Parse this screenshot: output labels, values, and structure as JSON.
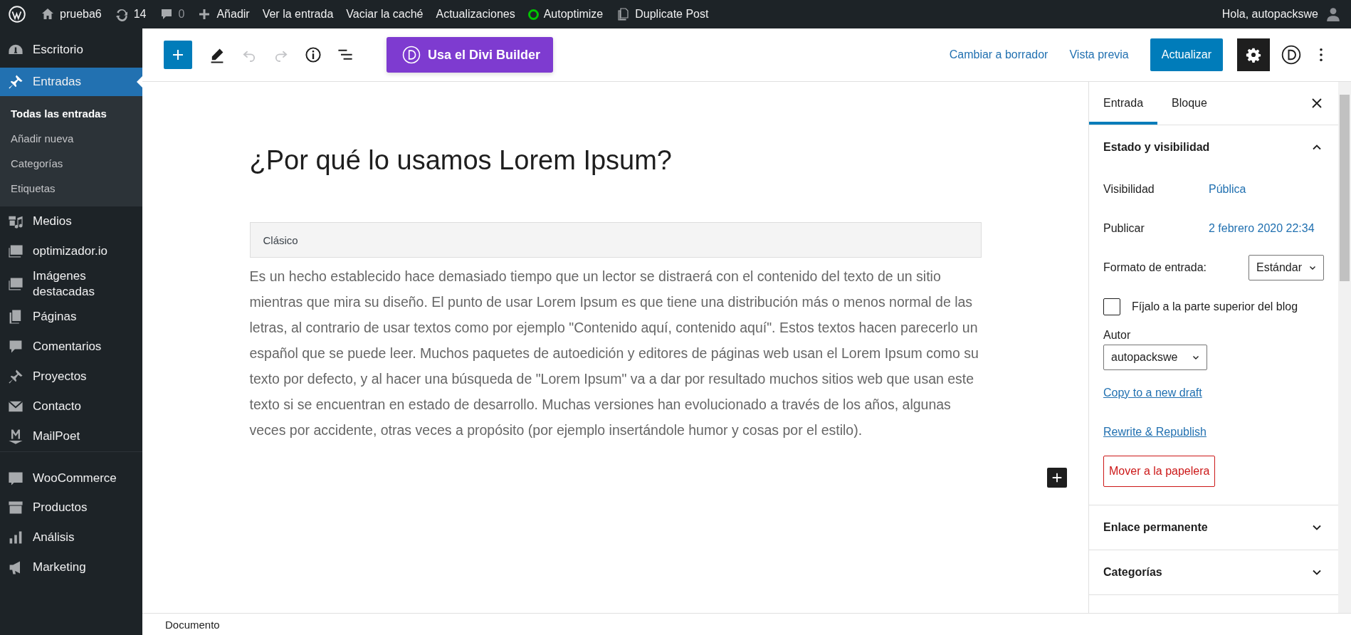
{
  "admin_bar": {
    "items": [
      {
        "kind": "logo"
      },
      {
        "kind": "site",
        "label": "prueba6"
      },
      {
        "kind": "updates",
        "label": "14"
      },
      {
        "kind": "comments",
        "label": "0"
      },
      {
        "kind": "new",
        "label": "Añadir"
      },
      {
        "kind": "link",
        "label": "Ver la entrada"
      },
      {
        "kind": "link",
        "label": "Vaciar la caché"
      },
      {
        "kind": "link",
        "label": "Actualizaciones"
      },
      {
        "kind": "status",
        "label": "Autoptimize",
        "color": "#00c400"
      },
      {
        "kind": "duplicate",
        "label": "Duplicate Post"
      }
    ],
    "greeting": "Hola, autopackswe"
  },
  "sidebar": {
    "items": [
      {
        "label": "Escritorio",
        "selected": false
      },
      {
        "label": "Entradas",
        "selected": true,
        "children": [
          {
            "label": "Todas las entradas",
            "selected": true
          },
          {
            "label": "Añadir nueva",
            "selected": false
          },
          {
            "label": "Categorías",
            "selected": false
          },
          {
            "label": "Etiquetas",
            "selected": false
          }
        ]
      },
      {
        "label": "Medios",
        "selected": false
      },
      {
        "label": "optimizador.io",
        "selected": false
      },
      {
        "label": "Imágenes destacadas",
        "selected": false
      },
      {
        "label": "Páginas",
        "selected": false
      },
      {
        "label": "Comentarios",
        "selected": false
      },
      {
        "label": "Proyectos",
        "selected": false
      },
      {
        "label": "Contacto",
        "selected": false
      },
      {
        "label": "MailPoet",
        "selected": false
      },
      {
        "label": "WooCommerce",
        "selected": false,
        "gap": true
      },
      {
        "label": "Productos",
        "selected": false
      },
      {
        "label": "Análisis",
        "selected": false
      },
      {
        "label": "Marketing",
        "selected": false
      }
    ]
  },
  "toolbar": {
    "divi_button": "Usa el Divi Builder",
    "links": [
      "Cambiar a borrador",
      "Vista previa"
    ],
    "update_button": "Actualizar",
    "settings_on": true
  },
  "editor": {
    "title": "¿Por qué lo usamos Lorem Ipsum?",
    "block_label": "Clásico",
    "paragraph": "Es un hecho establecido hace demasiado tiempo que un lector se distraerá con el contenido del texto de un sitio mientras que mira su diseño. El punto de usar Lorem Ipsum es que tiene una distribución más o menos normal de las letras, al contrario de usar textos como por ejemplo \"Contenido aquí, contenido aquí\". Estos textos hacen parecerlo un español que se puede leer. Muchos paquetes de autoedición y editores de páginas web usan el Lorem Ipsum como su texto por defecto, y al hacer una búsqueda de \"Lorem Ipsum\" va a dar por resultado muchos sitios web que usan este texto si se encuentran en estado de desarrollo. Muchas versiones han evolucionado a través de los años, algunas veces por accidente, otras veces a propósito (por ejemplo insertándole humor y cosas por el estilo)."
  },
  "panel": {
    "tabs": [
      {
        "label": "Entrada",
        "selected": true
      },
      {
        "label": "Bloque",
        "selected": false
      }
    ],
    "sections": [
      {
        "title": "Estado y visibilidad",
        "expanded": true,
        "rows": [
          {
            "kind": "pair",
            "label": "Visibilidad",
            "value": "Pública"
          },
          {
            "kind": "pair",
            "label": "Publicar",
            "value": "2 febrero 2020 22:34"
          },
          {
            "kind": "select-inline",
            "label": "Formato de entrada:",
            "value": "Estándar"
          },
          {
            "kind": "checkbox",
            "label": "Fíjalo a la parte superior del blog",
            "checked": false
          },
          {
            "kind": "select",
            "label": "Autor",
            "value": "autopackswe"
          },
          {
            "kind": "link",
            "label": "Copy to a new draft"
          },
          {
            "kind": "link",
            "label": "Rewrite & Republish"
          },
          {
            "kind": "danger",
            "label": "Mover a la papelera"
          }
        ]
      },
      {
        "title": "Enlace permanente",
        "expanded": false
      },
      {
        "title": "Categorías",
        "expanded": false
      }
    ]
  },
  "footer": {
    "breadcrumb": "Documento"
  }
}
